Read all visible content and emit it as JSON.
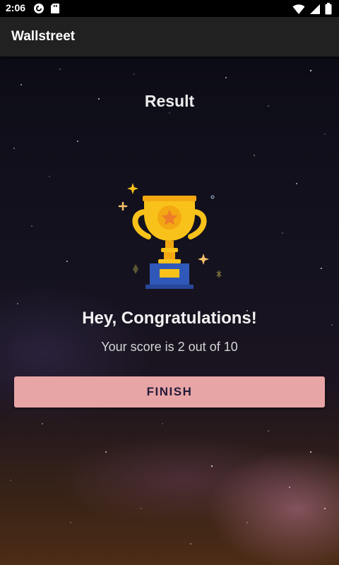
{
  "status_bar": {
    "time": "2:06",
    "icons": [
      "pocket-casts-icon",
      "sd-card-icon",
      "wifi-icon",
      "signal-icon",
      "battery-icon"
    ]
  },
  "app_bar": {
    "title": "Wallstreet"
  },
  "main": {
    "heading": "Result",
    "trophy_icon": "trophy-icon",
    "congrats_text": "Hey, Congratulations!",
    "score_text": "Your score is 2 out of 10",
    "finish_label": "FINISH"
  },
  "colors": {
    "app_bar": "#212121",
    "button": "#e8a5a6",
    "button_text": "#231a3a",
    "trophy_gold": "#f9c21a"
  }
}
